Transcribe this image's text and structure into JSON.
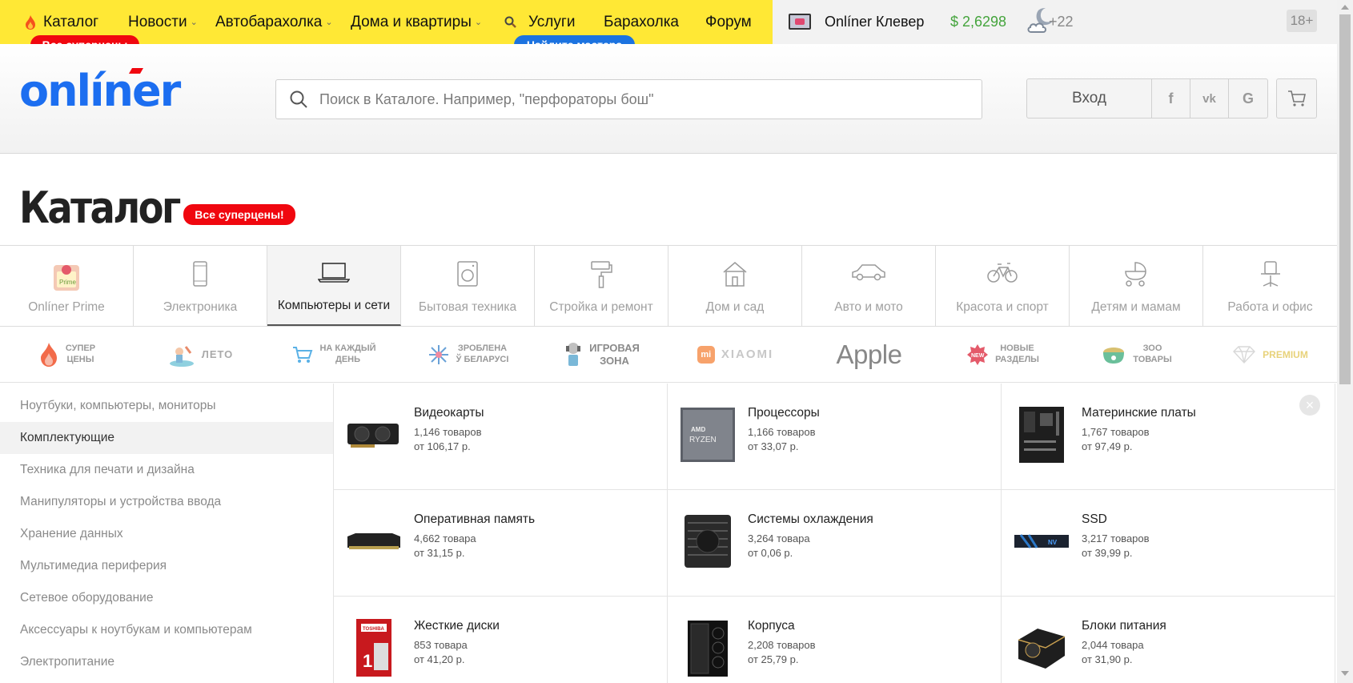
{
  "topbar": {
    "nav": [
      {
        "label": "Каталог",
        "chevron": false,
        "flame": true
      },
      {
        "label": "Новости",
        "chevron": true
      },
      {
        "label": "Автобарахолка",
        "chevron": true
      },
      {
        "label": "Дома и квартиры",
        "chevron": true
      },
      {
        "label": "Услуги",
        "chevron": false,
        "magnifier": true
      },
      {
        "label": "Барахолка",
        "chevron": false
      },
      {
        "label": "Форум",
        "chevron": false
      }
    ],
    "supersale_pill": "Все суперцены",
    "master_pill": "Найдите мастера",
    "clever_label": "Onlíner Клевер",
    "currency_rate": "$ 2,6298",
    "temperature": "+22",
    "age_badge": "18+",
    "brand_yellow": "#ffe835"
  },
  "header": {
    "logo_text": "onlíner",
    "logo_color": "#1c6ef0",
    "search_placeholder": "Поиск в Каталоге. Например, \"перфораторы бош\"",
    "login_label": "Вход",
    "social": [
      "f",
      "vk",
      "G"
    ],
    "icons": [
      "search-icon",
      "facebook-icon",
      "vk-icon",
      "google-icon",
      "cart-icon"
    ]
  },
  "title": {
    "text": "Каталог",
    "pill": "Все суперцены!"
  },
  "categories": [
    {
      "label": "Onlíner Prime",
      "icon": "prime-icon",
      "active": false
    },
    {
      "label": "Электроника",
      "icon": "smartphone-icon",
      "active": false
    },
    {
      "label": "Компьютеры и сети",
      "icon": "laptop-icon",
      "active": true
    },
    {
      "label": "Бытовая техника",
      "icon": "washing-machine-icon",
      "active": false
    },
    {
      "label": "Стройка и ремонт",
      "icon": "paint-roller-icon",
      "active": false
    },
    {
      "label": "Дом и сад",
      "icon": "house-icon",
      "active": false
    },
    {
      "label": "Авто и мото",
      "icon": "car-icon",
      "active": false
    },
    {
      "label": "Красота и спорт",
      "icon": "bicycle-icon",
      "active": false
    },
    {
      "label": "Детям и мамам",
      "icon": "stroller-icon",
      "active": false
    },
    {
      "label": "Работа и офис",
      "icon": "office-chair-icon",
      "active": false
    }
  ],
  "promos": [
    {
      "label": "СУПЕР\nЦЕНЫ",
      "icon": "flame-icon",
      "color": "#f26b4a"
    },
    {
      "label": "ЛЕТО",
      "icon": "summer-icon",
      "color": "#7fc6d8"
    },
    {
      "label": "НА КАЖДЫЙ\nДЕНЬ",
      "icon": "cart-promo-icon",
      "color": "#5ab1e6"
    },
    {
      "label": "ЗРОБЛЕНА\nЎ БЕЛАРУСІ",
      "icon": "snowflake-icon",
      "color": "#6aa2d8"
    },
    {
      "label": "ИГРОВАЯ\nЗОНА",
      "icon": "gamer-icon",
      "color": "#a0a0a0"
    },
    {
      "label": "XIAOMI",
      "icon": "xiaomi-icon",
      "color": "#f7a26b"
    },
    {
      "label": "Apple",
      "icon": "apple-wordmark",
      "color": "#888888"
    },
    {
      "label": "НОВЫЕ\nРАЗДЕЛЫ",
      "icon": "new-badge-icon",
      "color": "#e45a6a"
    },
    {
      "label": "ЗОО\nТОВАРЫ",
      "icon": "pet-food-icon",
      "color": "#6abf9a"
    },
    {
      "label": "PREMIUM",
      "icon": "diamond-icon",
      "color": "#e8d27a"
    }
  ],
  "sidebar": [
    {
      "label": "Ноутбуки, компьютеры, мониторы",
      "active": false
    },
    {
      "label": "Комплектующие",
      "active": true
    },
    {
      "label": "Техника для печати и дизайна",
      "active": false
    },
    {
      "label": "Манипуляторы и устройства ввода",
      "active": false
    },
    {
      "label": "Хранение данных",
      "active": false
    },
    {
      "label": "Мультимедиа периферия",
      "active": false
    },
    {
      "label": "Сетевое оборудование",
      "active": false
    },
    {
      "label": "Аксессуары к ноутбукам и компьютерам",
      "active": false
    },
    {
      "label": "Электропитание",
      "active": false
    }
  ],
  "products": [
    {
      "name": "Видеокарты",
      "count": "1,146 товаров",
      "price": "от 106,17 р.",
      "icon": "graphics-card-icon"
    },
    {
      "name": "Процессоры",
      "count": "1,166 товаров",
      "price": "от 33,07 р.",
      "icon": "cpu-icon"
    },
    {
      "name": "Материнские платы",
      "count": "1,767 товаров",
      "price": "от 97,49 р.",
      "icon": "motherboard-icon"
    },
    {
      "name": "Оперативная память",
      "count": "4,662 товара",
      "price": "от 31,15 р.",
      "icon": "ram-icon"
    },
    {
      "name": "Системы охлаждения",
      "count": "3,264 товара",
      "price": "от 0,06 р.",
      "icon": "cooler-icon"
    },
    {
      "name": "SSD",
      "count": "3,217 товаров",
      "price": "от 39,99 р.",
      "icon": "ssd-icon"
    },
    {
      "name": "Жесткие диски",
      "count": "853 товара",
      "price": "от 41,20 р.",
      "icon": "hdd-icon"
    },
    {
      "name": "Корпуса",
      "count": "2,208 товаров",
      "price": "от 25,79 р.",
      "icon": "pc-case-icon"
    },
    {
      "name": "Блоки питания",
      "count": "2,044 товара",
      "price": "от 31,90 р.",
      "icon": "psu-icon"
    }
  ]
}
